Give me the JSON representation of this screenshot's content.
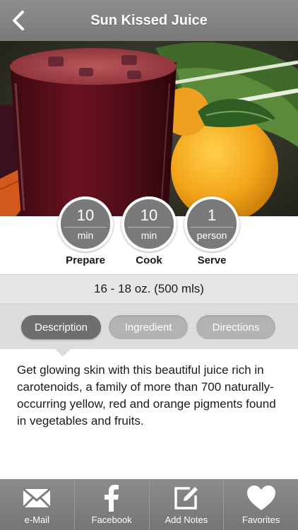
{
  "header": {
    "title": "Sun Kissed Juice",
    "back_icon": "chevron-left-icon"
  },
  "hero": {
    "alt": "Glass of red juice with orange, carrots and greens"
  },
  "stats": [
    {
      "value": "10",
      "unit": "min",
      "label": "Prepare"
    },
    {
      "value": "10",
      "unit": "min",
      "label": "Cook"
    },
    {
      "value": "1",
      "unit": "person",
      "label": "Serve"
    }
  ],
  "serving_size": "16 - 18 oz. (500 mls)",
  "tabs": [
    {
      "label": "Description",
      "active": true
    },
    {
      "label": "Ingredient",
      "active": false
    },
    {
      "label": "Directions",
      "active": false
    }
  ],
  "description": "Get glowing skin with this beautiful juice rich in carotenoids, a family of more than 700 naturally-occurring yellow, red and orange pigments found in vegetables and fruits.",
  "toolbar": [
    {
      "label": "e-Mail",
      "icon": "mail-icon"
    },
    {
      "label": "Facebook",
      "icon": "facebook-icon"
    },
    {
      "label": "Add Notes",
      "icon": "edit-note-icon"
    },
    {
      "label": "Favorites",
      "icon": "heart-icon"
    }
  ],
  "colors": {
    "header_bg": "#7f7f7f",
    "active_tab": "#6e6e6e",
    "inactive_tab": "#b3b3b3",
    "stat_circle": "#7a7a7a"
  }
}
